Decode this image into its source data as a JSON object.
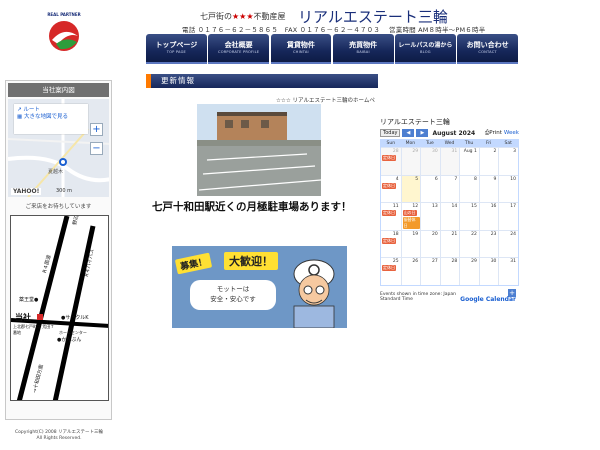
{
  "header": {
    "logo_text": "REAL PARTNER",
    "tagline_prefix": "七戸街の",
    "tagline_stars": "★★★",
    "tagline_suffix": "不動産屋",
    "brand": "リアルエステート三輪",
    "contact": "電話 ０１７６－６２－５８６５　FAX ０１７６－６２－４７０３　 営業時間 AM８時半～PM６時半"
  },
  "nav": [
    {
      "jp": "トップページ",
      "en": "TOP PAGE"
    },
    {
      "jp": "会社概要",
      "en": "CORPORATE PROFILE"
    },
    {
      "jp": "賃貸物件",
      "en": "CHINTAI"
    },
    {
      "jp": "売買物件",
      "en": "BAIBAI"
    },
    {
      "jp": "レールパスの湯から",
      "en": "BLOG"
    },
    {
      "jp": "お問い合わせ",
      "en": "CONTACT"
    }
  ],
  "sidebar": {
    "title": "当社案内図",
    "map_route": "ルート",
    "map_large": "大きな地図で見る",
    "map_place": "夏越木",
    "map_brand": "YAHOO!",
    "map_scale": "300 m",
    "note": "ご来店をお待ちしています",
    "sketch": {
      "road1": "野辺地街道→",
      "road2": "R４国道",
      "road3": "R４バイパス",
      "landmark1": "薬王堂●",
      "company": "当社",
      "circlek": "●サークルK",
      "address": "上北郡七戸町字 荒田７番地",
      "homecenter": "ホームセンター",
      "kanbun": "●かんぶん",
      "road4": "→十和田方面"
    }
  },
  "copyright": {
    "line1": "Copyright(C) 2008 リアルエステート三輪",
    "line2": "All Rights Reserved."
  },
  "main": {
    "news_title": "更新情報",
    "marquee": "☆☆☆ リアルエステート三輪のホームペ",
    "headline": "七戸十和田駅近くの月極駐車場あります！",
    "recruit": {
      "badge1": "募集！",
      "badge2": "大歓迎！",
      "motto1": "モットーは",
      "motto2": "安全・安心です"
    }
  },
  "calendar": {
    "title": "リアルエステート三輪",
    "today_label": "Today",
    "month_label": "August 2024",
    "print_label": "Print",
    "week_label": "Week",
    "weekdays": [
      "Sun",
      "Mon",
      "Tue",
      "Wed",
      "Thu",
      "Fri",
      "Sat"
    ],
    "weeks": [
      [
        {
          "d": "28",
          "o": true
        },
        {
          "d": "29",
          "o": true
        },
        {
          "d": "30",
          "o": true
        },
        {
          "d": "31",
          "o": true
        },
        {
          "d": "Aug 1"
        },
        {
          "d": "2"
        },
        {
          "d": "3"
        }
      ],
      [
        {
          "d": "4",
          "ev": "定休日"
        },
        {
          "d": "5",
          "t": true
        },
        {
          "d": "6"
        },
        {
          "d": "7"
        },
        {
          "d": "8"
        },
        {
          "d": "9"
        },
        {
          "d": "10"
        }
      ],
      [
        {
          "d": "11",
          "ev": "定休日"
        },
        {
          "d": "12",
          "ev": "山の日",
          "ev2": "振替休日"
        },
        {
          "d": "13"
        },
        {
          "d": "14"
        },
        {
          "d": "15"
        },
        {
          "d": "16"
        },
        {
          "d": "17"
        }
      ],
      [
        {
          "d": "18",
          "ev": "定休日"
        },
        {
          "d": "19"
        },
        {
          "d": "20"
        },
        {
          "d": "21"
        },
        {
          "d": "22"
        },
        {
          "d": "23"
        },
        {
          "d": "24"
        }
      ],
      [
        {
          "d": "25",
          "ev": "定休日"
        },
        {
          "d": "26"
        },
        {
          "d": "27"
        },
        {
          "d": "28"
        },
        {
          "d": "29"
        },
        {
          "d": "30"
        },
        {
          "d": "31"
        }
      ]
    ],
    "sunday_prefix_event": "定休日",
    "footer_tz": "Events shown in time zone: Japan Standard Time",
    "gcal": "Google Calendar",
    "plus": "+"
  },
  "colors": {
    "nav_bg": "#16275a",
    "accent": "#ff7a00",
    "event": "#e8633f"
  }
}
